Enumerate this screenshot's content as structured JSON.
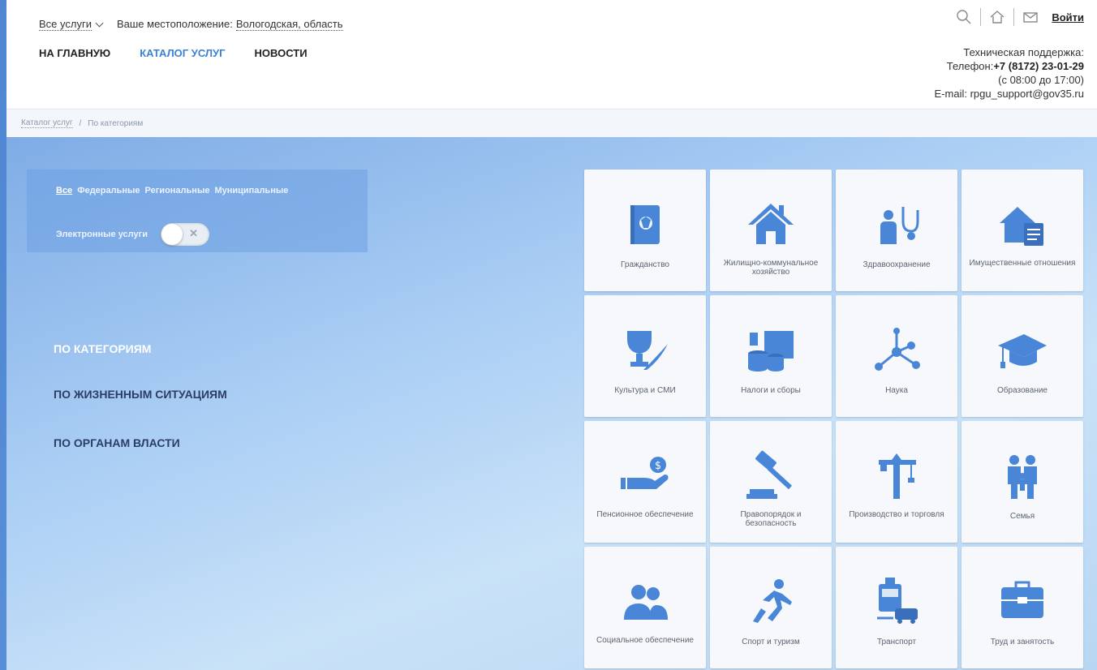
{
  "header": {
    "services_dropdown": "Все услуги",
    "location_label": "Ваше местоположение:",
    "location_value": "Вологодская, область",
    "nav": [
      {
        "label": "НА ГЛАВНУЮ",
        "active": false
      },
      {
        "label": "КАТАЛОГ УСЛУГ",
        "active": true
      },
      {
        "label": "НОВОСТИ",
        "active": false
      }
    ],
    "login_label": "Войти",
    "support": {
      "title": "Техническая поддержка:",
      "phone_label": "Телефон:",
      "phone": "+7 (8172) 23-01-29",
      "hours": "(с 08:00 до 17:00)",
      "email_label": "E-mail:",
      "email": "rpgu_support@gov35.ru"
    }
  },
  "breadcrumb": {
    "items": [
      "Каталог услуг",
      "/",
      "По категориям"
    ]
  },
  "filter": {
    "tabs": [
      {
        "label": "Все",
        "selected": true
      },
      {
        "label": "Федеральные",
        "selected": false
      },
      {
        "label": "Региональные",
        "selected": false
      },
      {
        "label": "Муниципальные",
        "selected": false
      }
    ],
    "eservices_label": "Электронные услуги",
    "eservices_on": false
  },
  "leftnav": [
    {
      "label": "ПО КАТЕГОРИЯМ",
      "active": true
    },
    {
      "label": "ПО ЖИЗНЕННЫМ СИТУАЦИЯМ",
      "active": false
    },
    {
      "label": "ПО ОРГАНАМ ВЛАСТИ",
      "active": false
    }
  ],
  "categories": [
    {
      "label": "Гражданство",
      "icon": "passport-icon"
    },
    {
      "label": "Жилищно-коммунальное хозяйство",
      "icon": "house-icon"
    },
    {
      "label": "Здравоохранение",
      "icon": "stethoscope-icon"
    },
    {
      "label": "Имущественные отношения",
      "icon": "property-icon"
    },
    {
      "label": "Культура и СМИ",
      "icon": "trophy-quill-icon"
    },
    {
      "label": "Налоги и сборы",
      "icon": "coins-icon"
    },
    {
      "label": "Наука",
      "icon": "molecule-icon"
    },
    {
      "label": "Образование",
      "icon": "graduation-cap-icon"
    },
    {
      "label": "Пенсионное обеспечение",
      "icon": "hand-coin-icon"
    },
    {
      "label": "Правопорядок и безопасность",
      "icon": "gavel-icon"
    },
    {
      "label": "Производство и торговля",
      "icon": "crane-icon"
    },
    {
      "label": "Семья",
      "icon": "family-icon"
    },
    {
      "label": "Социальное обеспечение",
      "icon": "people-icon"
    },
    {
      "label": "Спорт и туризм",
      "icon": "runner-icon"
    },
    {
      "label": "Транспорт",
      "icon": "transport-icon"
    },
    {
      "label": "Труд и занятость",
      "icon": "briefcase-icon"
    }
  ],
  "colors": {
    "accent": "#3b82d6",
    "icon": "#4a86d8"
  }
}
